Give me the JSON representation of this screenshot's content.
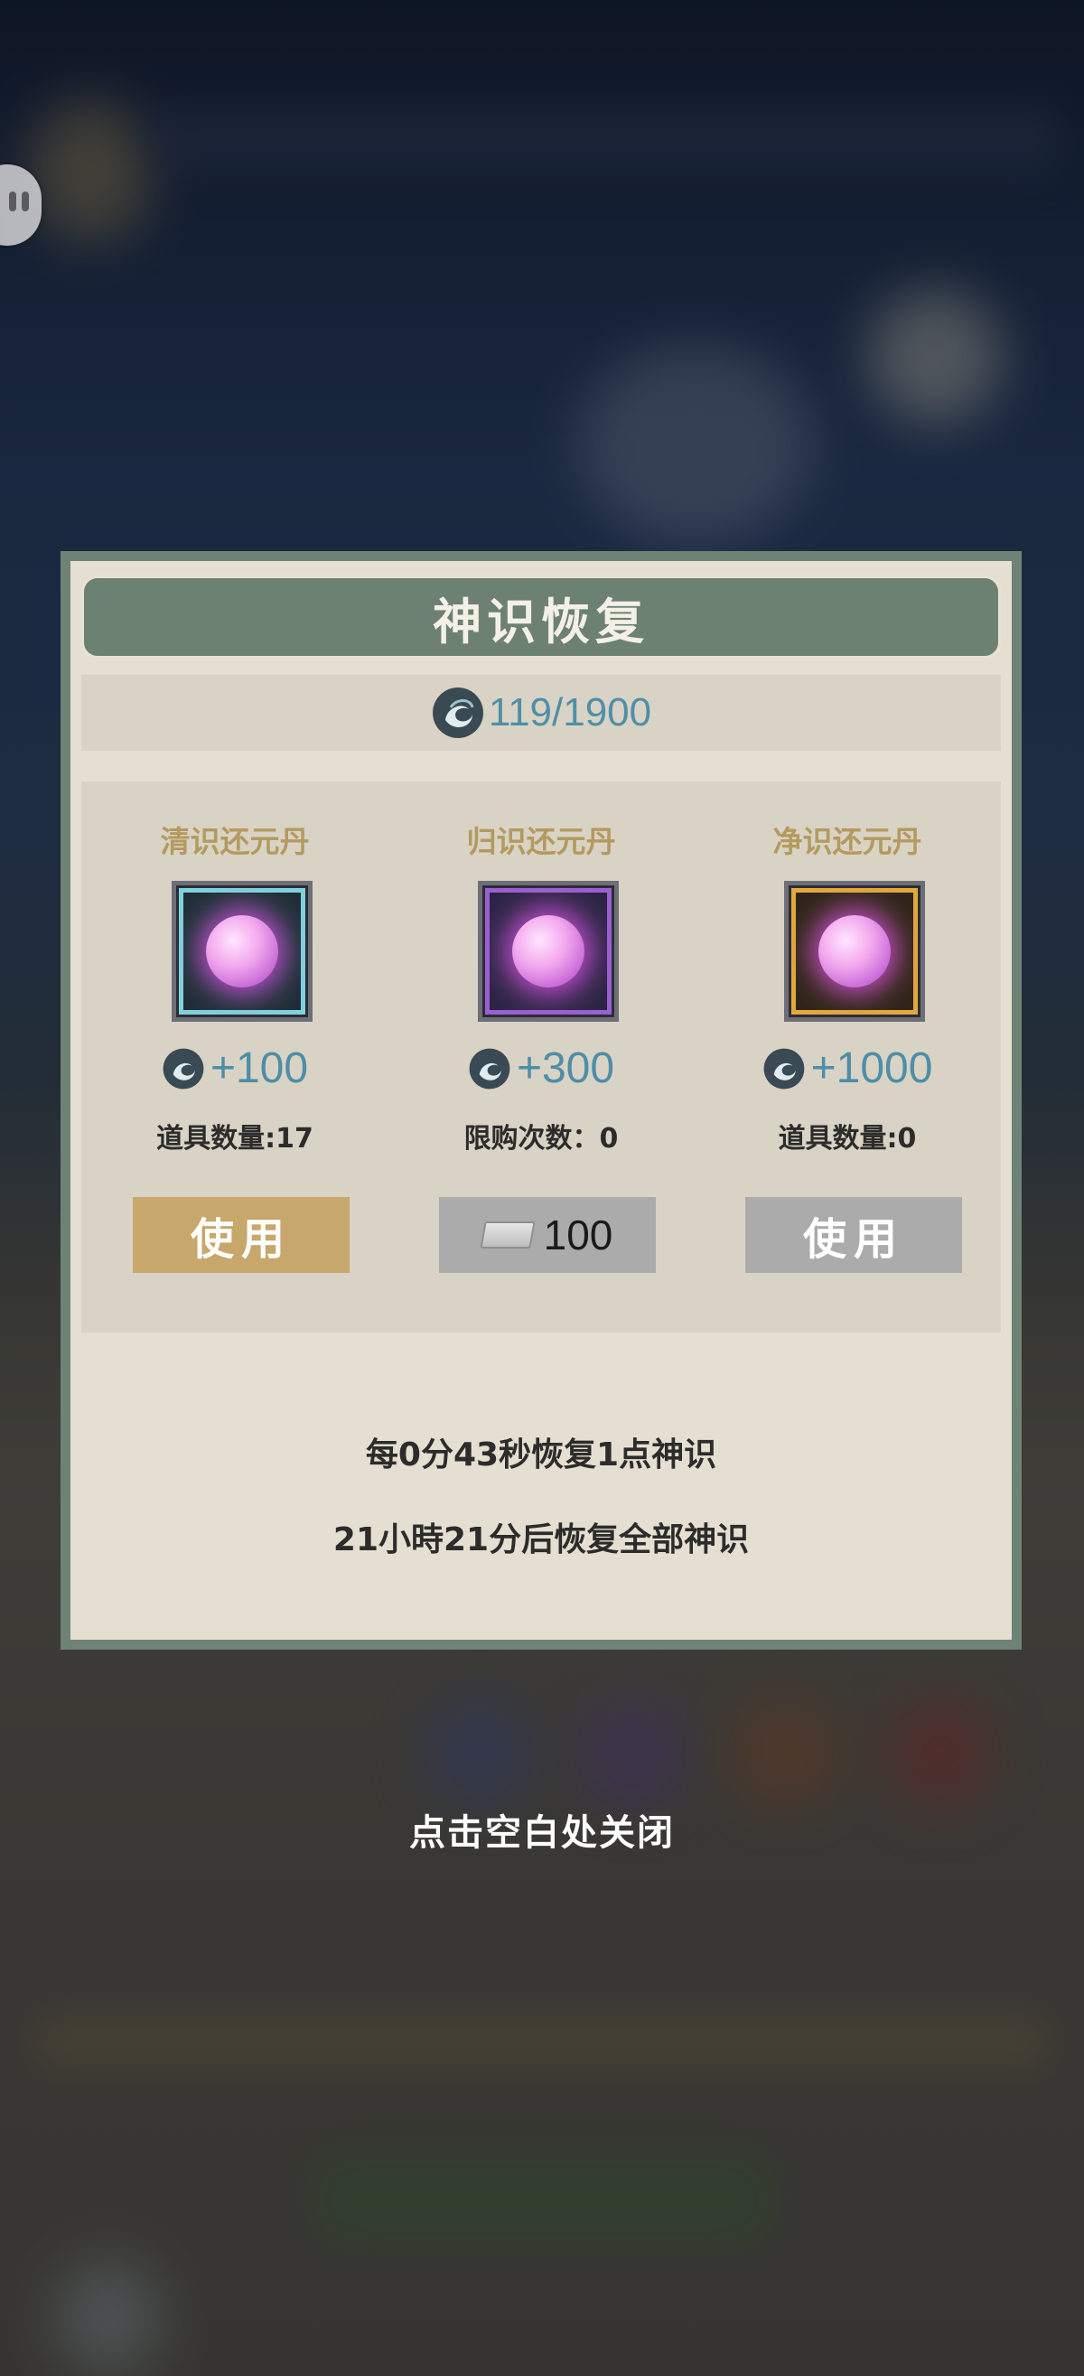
{
  "dialog": {
    "title": "神识恢复",
    "energy": "119/1900"
  },
  "items": [
    {
      "name": "清识还元丹",
      "gain": "+100",
      "meta": "道具数量:17",
      "button_label": "使用",
      "frame_color": "#7ed2dc",
      "button_color": "#c7a76b"
    },
    {
      "name": "归识还元丹",
      "gain": "+300",
      "meta": "限购次数：0",
      "button_price": "100",
      "button_icon": "ticket-icon",
      "frame_color": "#9a5fd0",
      "button_color": "#ababab"
    },
    {
      "name": "净识还元丹",
      "gain": "+1000",
      "meta": "道具数量:0",
      "button_label": "使用",
      "frame_color": "#e0a93a",
      "button_color": "#ababab"
    }
  ],
  "recovery": {
    "rate": "每0分43秒恢复1点神识",
    "full": "21小時21分后恢复全部神识"
  },
  "close_hint": "点击空白处关闭"
}
